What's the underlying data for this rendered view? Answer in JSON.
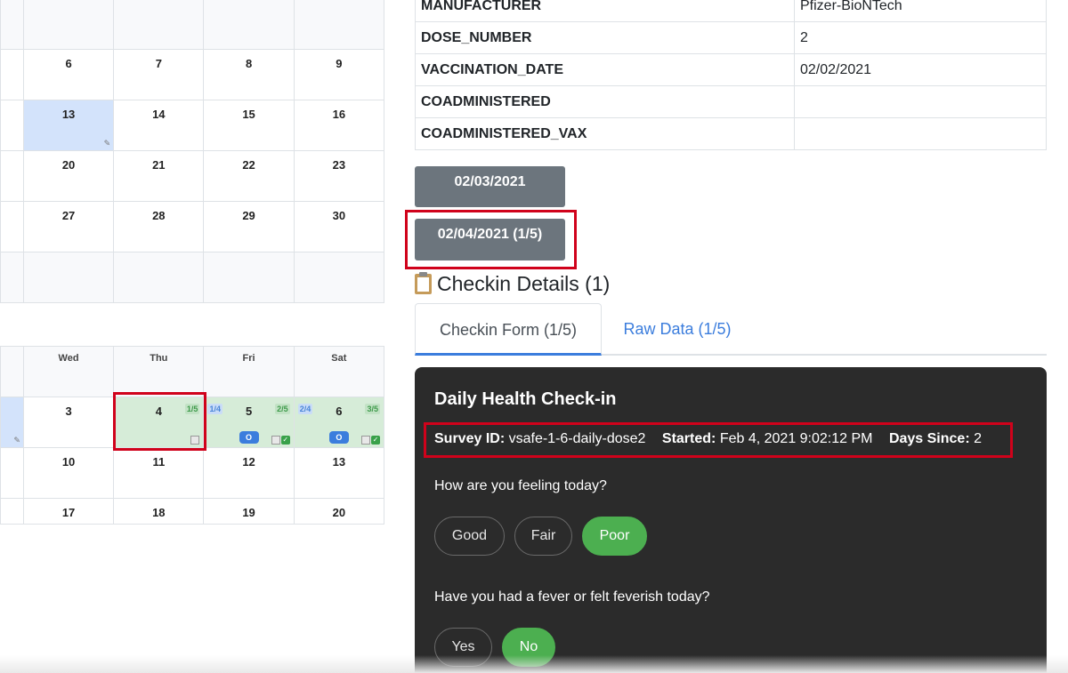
{
  "calendar_top": {
    "rows": [
      [
        "",
        "",
        "",
        "",
        ""
      ],
      [
        "",
        "6",
        "7",
        "8",
        "9"
      ],
      [
        "",
        "13",
        "14",
        "15",
        "16"
      ],
      [
        "",
        "20",
        "21",
        "22",
        "23"
      ],
      [
        "",
        "27",
        "28",
        "29",
        "30"
      ],
      [
        "",
        "",
        "",
        "",
        ""
      ]
    ]
  },
  "calendar_bottom": {
    "headers": [
      "",
      "Wed",
      "Thu",
      "Fri",
      "Sat"
    ],
    "rows": [
      [
        "",
        "3",
        "4",
        "5",
        "6"
      ],
      [
        "",
        "10",
        "11",
        "12",
        "13"
      ],
      [
        "",
        "17",
        "18",
        "19",
        "20"
      ]
    ],
    "thu_tag": "1/5",
    "fri_tag_left": "1/4",
    "fri_tag_right": "2/5",
    "sat_tag_left": "2/4",
    "sat_tag_right": "3/5",
    "pill_label": "O"
  },
  "vaccine_info": {
    "rows": [
      {
        "key": "MANUFACTURER",
        "value": "Pfizer-BioNTech"
      },
      {
        "key": "DOSE_NUMBER",
        "value": "2"
      },
      {
        "key": "VACCINATION_DATE",
        "value": "02/02/2021"
      },
      {
        "key": "COADMINISTERED",
        "value": ""
      },
      {
        "key": "COADMINISTERED_VAX",
        "value": ""
      }
    ]
  },
  "date_buttons": [
    "02/03/2021",
    "02/04/2021 (1/5)"
  ],
  "checkin": {
    "title": "Checkin Details (1)",
    "tabs": [
      "Checkin Form (1/5)",
      "Raw Data (1/5)"
    ],
    "form_title": "Daily Health Check-in",
    "survey_id_label": "Survey ID:",
    "survey_id": "vsafe-1-6-daily-dose2",
    "started_label": "Started:",
    "started": "Feb 4, 2021 9:02:12 PM",
    "days_since_label": "Days Since:",
    "days_since": "2",
    "q1": "How are you feeling today?",
    "q1_options": [
      "Good",
      "Fair",
      "Poor"
    ],
    "q1_selected": "Poor",
    "q2": "Have you had a fever or felt feverish today?",
    "q2_options": [
      "Yes",
      "No"
    ],
    "q2_selected": "No"
  },
  "colors": {
    "accent": "#3b7ddd",
    "selected_green": "#4caf50",
    "highlight_red": "#d0021b",
    "button_gray": "#6c757d"
  }
}
